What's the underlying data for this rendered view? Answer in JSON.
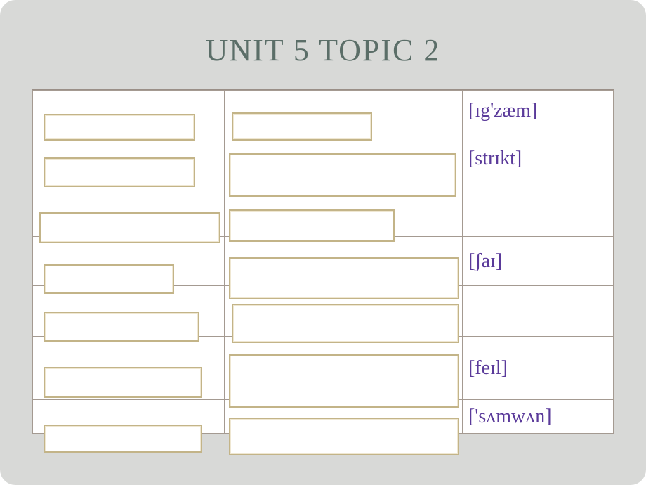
{
  "title": "UNIT 5 TOPIC 2",
  "rows": [
    {
      "ipa": "[ɪg'zæm]"
    },
    {
      "ipa": "[strɪkt]"
    },
    {
      "ipa": ""
    },
    {
      "ipa": "[ʃaɪ]"
    },
    {
      "ipa": ""
    },
    {
      "ipa": "[feɪl]"
    },
    {
      "ipa": "['sʌmwʌn]"
    }
  ]
}
